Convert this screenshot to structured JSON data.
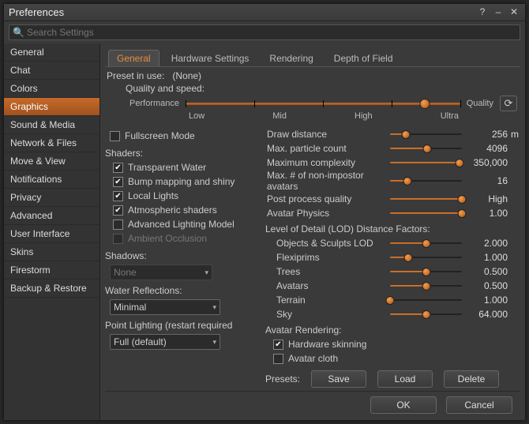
{
  "window": {
    "title": "Preferences",
    "search_placeholder": "Search Settings"
  },
  "sidebar": {
    "items": [
      "General",
      "Chat",
      "Colors",
      "Graphics",
      "Sound & Media",
      "Network & Files",
      "Move & View",
      "Notifications",
      "Privacy",
      "Advanced",
      "User Interface",
      "Skins",
      "Firestorm",
      "Backup & Restore"
    ],
    "active": 3
  },
  "tabs": {
    "items": [
      "General",
      "Hardware Settings",
      "Rendering",
      "Depth of Field"
    ],
    "active": 0
  },
  "preset": {
    "label": "Preset in use:",
    "value": "(None)"
  },
  "quality": {
    "heading": "Quality and speed:",
    "left": "Performance",
    "right": "Quality",
    "ticks": [
      "Low",
      "Mid",
      "High",
      "Ultra"
    ],
    "pos": 0.87
  },
  "left": {
    "fullscreen": {
      "label": "Fullscreen Mode",
      "checked": false
    },
    "shaders_h": "Shaders:",
    "shaders": [
      {
        "label": "Transparent Water",
        "checked": true
      },
      {
        "label": "Bump mapping and shiny",
        "checked": true
      },
      {
        "label": "Local Lights",
        "checked": true
      },
      {
        "label": "Atmospheric shaders",
        "checked": true
      },
      {
        "label": "Advanced Lighting Model",
        "checked": false
      },
      {
        "label": "Ambient Occlusion",
        "checked": false,
        "disabled": true
      }
    ],
    "shadows_h": "Shadows:",
    "shadows_val": "None",
    "reflect_h": "Water Reflections:",
    "reflect_val": "Minimal",
    "point_h": "Point Lighting (restart required",
    "point_val": "Full (default)"
  },
  "right": {
    "sliders1": [
      {
        "label": "Draw distance",
        "pos": 0.22,
        "value": "256",
        "unit": "m"
      },
      {
        "label": "Max. particle count",
        "pos": 0.52,
        "value": "4096"
      },
      {
        "label": "Maximum complexity",
        "pos": 0.97,
        "value": "350,000"
      },
      {
        "label": "Max. # of non-impostor avatars",
        "pos": 0.24,
        "value": "16"
      },
      {
        "label": "Post process quality",
        "pos": 1.0,
        "value": "High"
      },
      {
        "label": "Avatar Physics",
        "pos": 1.0,
        "value": "1.00"
      }
    ],
    "lod_h": "Level of Detail (LOD) Distance Factors:",
    "sliders2": [
      {
        "label": "Objects & Sculpts LOD",
        "pos": 0.5,
        "value": "2.000"
      },
      {
        "label": "Flexiprims",
        "pos": 0.25,
        "value": "1.000"
      },
      {
        "label": "Trees",
        "pos": 0.5,
        "value": "0.500"
      },
      {
        "label": "Avatars",
        "pos": 0.5,
        "value": "0.500"
      },
      {
        "label": "Terrain",
        "pos": 0.0,
        "value": "1.000"
      },
      {
        "label": "Sky",
        "pos": 0.5,
        "value": "64.000"
      }
    ],
    "avr_h": "Avatar Rendering:",
    "avr": [
      {
        "label": "Hardware skinning",
        "checked": true
      },
      {
        "label": "Avatar cloth",
        "checked": false
      }
    ],
    "presets_label": "Presets:",
    "btn_save": "Save",
    "btn_load": "Load",
    "btn_delete": "Delete"
  },
  "footer": {
    "ok": "OK",
    "cancel": "Cancel"
  }
}
